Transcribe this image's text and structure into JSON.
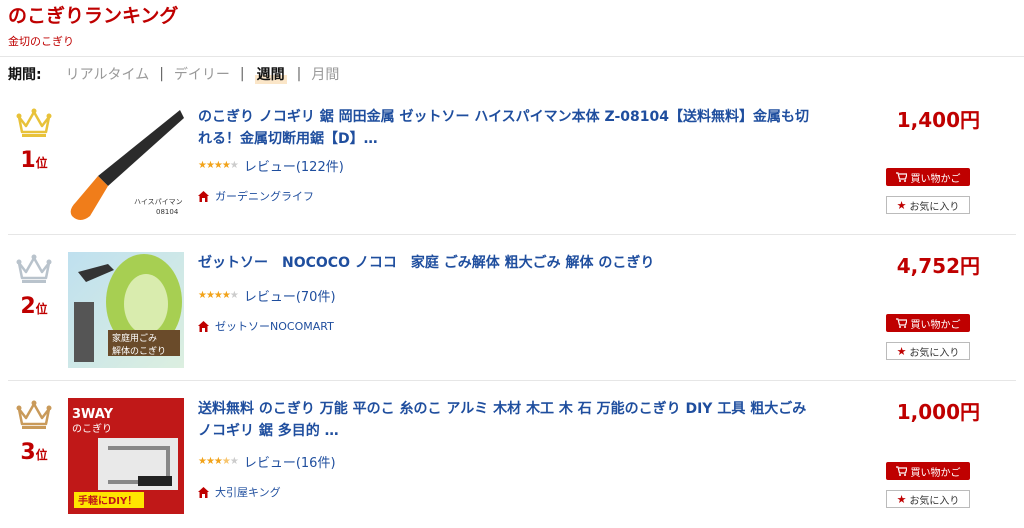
{
  "header": {
    "title": "のこぎりランキング",
    "subtitle": "金切のこぎり"
  },
  "period": {
    "label": "期間:",
    "options": [
      "リアルタイム",
      "デイリー",
      "週間",
      "月間"
    ],
    "separator": "|",
    "active": "週間"
  },
  "items": [
    {
      "rank": "1",
      "rank_suffix": "位",
      "crown_color": "#e8c23a",
      "name": "のこぎり ノコギリ 鋸 岡田金属 ゼットソー ハイスパイマン本体 Z-08104【送料無料】金属も切れる！金属切断用鋸【D】…",
      "rating_stars": 4,
      "review": "レビュー(122件)",
      "shop": "ガーデニングライフ",
      "price": "1,400円",
      "cart_label": "買い物かご",
      "fav_label": "お気に入り",
      "image_text": "ハイスパイマン 08104"
    },
    {
      "rank": "2",
      "rank_suffix": "位",
      "crown_color": "#b9c3cc",
      "name": "ゼットソー　NOCOCO ノココ　家庭 ごみ解体 粗大ごみ 解体 のこぎり",
      "rating_stars": 4,
      "review": "レビュー(70件)",
      "shop": "ゼットソーNOCOMART",
      "price": "4,752円",
      "cart_label": "買い物かご",
      "fav_label": "お気に入り",
      "image_text": "家庭用ごみ 解体のこぎり"
    },
    {
      "rank": "3",
      "rank_suffix": "位",
      "crown_color": "#c99a5a",
      "name": "送料無料 のこぎり 万能 平のこ 糸のこ アルミ 木材 木工 木 石 万能のこぎり DIY 工具 粗大ごみ ノコギリ 鋸 多目的 …",
      "rating_stars": 3.5,
      "review": "レビュー(16件)",
      "shop": "大引屋キング",
      "price": "1,000円",
      "cart_label": "買い物かご",
      "fav_label": "お気に入り",
      "image_text": "3WAY のこぎり 手軽にDIY！"
    }
  ]
}
